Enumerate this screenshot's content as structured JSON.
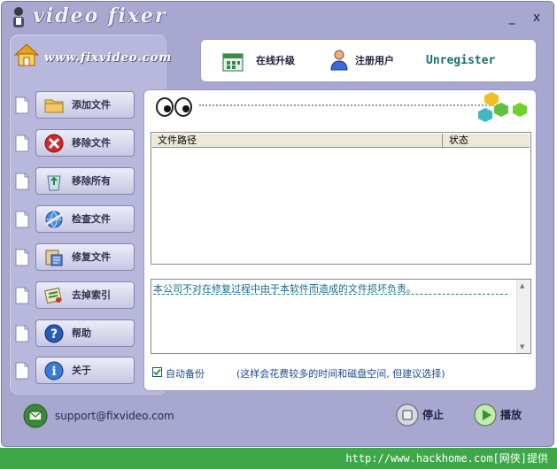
{
  "app": {
    "title": "video fixer",
    "site_url": "www.fixvideo.com",
    "minimize": "_",
    "close": "x"
  },
  "header": {
    "upgrade": "在线升级",
    "register": "注册用户",
    "status": "Unregister"
  },
  "sidebar": {
    "items": [
      {
        "label": "添加文件",
        "icon": "folder-icon"
      },
      {
        "label": "移除文件",
        "icon": "remove-icon"
      },
      {
        "label": "移除所有",
        "icon": "recycle-bin-icon"
      },
      {
        "label": "检查文件",
        "icon": "check-globe-icon"
      },
      {
        "label": "修复文件",
        "icon": "repair-icon"
      },
      {
        "label": "去掉索引",
        "icon": "index-icon"
      },
      {
        "label": "帮助",
        "icon": "help-icon"
      },
      {
        "label": "关于",
        "icon": "info-icon"
      }
    ]
  },
  "table": {
    "columns": [
      "文件路径",
      "状态"
    ],
    "rows": []
  },
  "log": {
    "text": "本公司不对在修复过程中由于本软件而造成的文件损坏负责。"
  },
  "options": {
    "auto_backup_label": "自动备份",
    "auto_backup_checked": true,
    "hint": "(这样会花费较多的时间和磁盘空间, 但建议选择)"
  },
  "footer": {
    "support": "support@fixvideo.com",
    "stop": "停止",
    "play": "播放"
  },
  "watermark": {
    "text": "http://www.hackhome.com[网侠]提供"
  },
  "colors": {
    "window_bg": "#a7a7cf",
    "panel_bg": "#b8b8dc",
    "accent_teal": "#1c6e6e",
    "watermark_green": "#3ea849"
  }
}
